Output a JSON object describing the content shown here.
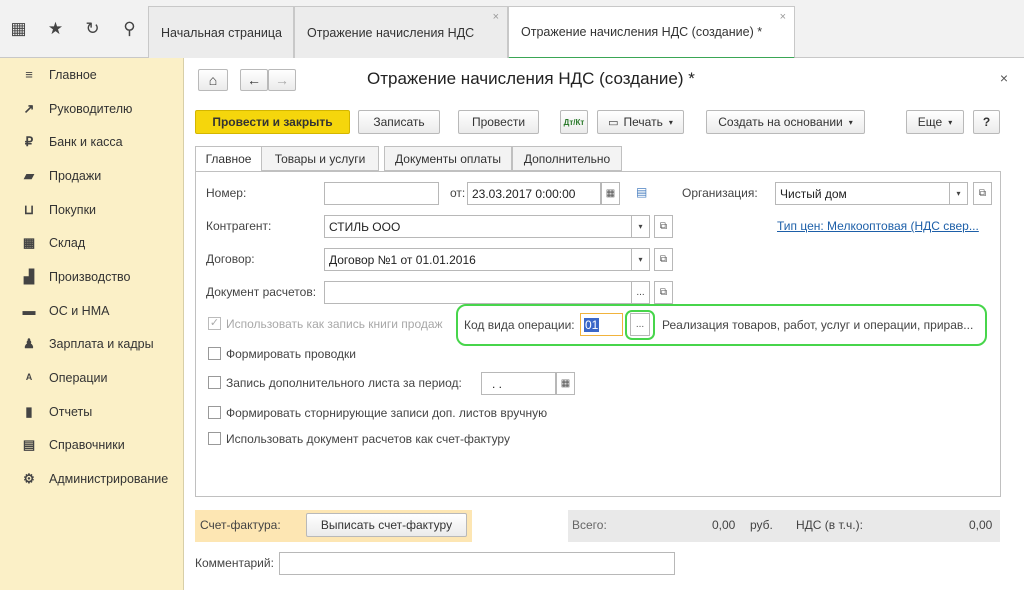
{
  "topbar": {
    "icons": [
      "apps-grid-icon",
      "star-icon",
      "history-icon",
      "search-icon"
    ],
    "tabs": [
      {
        "label": "Начальная страница"
      },
      {
        "label": "Отражение начисления НДС"
      },
      {
        "label": "Отражение начисления НДС (создание) *"
      }
    ],
    "close_glyph": "×"
  },
  "sidebar": {
    "items": [
      {
        "label": "Главное",
        "icon": "menu-icon",
        "glyph": "≡"
      },
      {
        "label": "Руководителю",
        "icon": "trend-icon",
        "glyph": "↗"
      },
      {
        "label": "Банк и касса",
        "icon": "ruble-coin-icon",
        "glyph": "₽"
      },
      {
        "label": "Продажи",
        "icon": "bag-icon",
        "glyph": "▰"
      },
      {
        "label": "Покупки",
        "icon": "cart-icon",
        "glyph": "⊔"
      },
      {
        "label": "Склад",
        "icon": "warehouse-icon",
        "glyph": "▦"
      },
      {
        "label": "Производство",
        "icon": "factory-icon",
        "glyph": "▟"
      },
      {
        "label": "ОС и НМА",
        "icon": "truck-icon",
        "glyph": "▬"
      },
      {
        "label": "Зарплата и кадры",
        "icon": "person-icon",
        "glyph": "♟"
      },
      {
        "label": "Операции",
        "icon": "debit-credit-icon",
        "glyph": "ᴬ"
      },
      {
        "label": "Отчеты",
        "icon": "bar-chart-icon",
        "glyph": "▮"
      },
      {
        "label": "Справочники",
        "icon": "book-icon",
        "glyph": "▤"
      },
      {
        "label": "Администрирование",
        "icon": "gear-icon",
        "glyph": "⚙"
      }
    ]
  },
  "document": {
    "title": "Отражение начисления НДС (создание) *",
    "nav": {
      "home": "⌂",
      "back": "←",
      "forward": "→"
    },
    "toolbar": {
      "post_and_close": "Провести и закрыть",
      "save": "Записать",
      "post": "Провести",
      "dtkt": "Дт/Кт",
      "print": "Печать",
      "create_based_on": "Создать на основании",
      "more": "Еще",
      "help": "?"
    },
    "tabs": [
      "Главное",
      "Товары и услуги",
      "Документы оплаты",
      "Дополнительно"
    ],
    "fields": {
      "number_label": "Номер:",
      "number_value": "",
      "date_label": "от:",
      "date_value": "23.03.2017  0:00:00",
      "org_label": "Организация:",
      "org_value": "Чистый дом",
      "counterparty_label": "Контрагент:",
      "counterparty_value": "СТИЛЬ ООО",
      "price_type_link": "Тип цен: Мелкооптовая (НДС свер...",
      "contract_label": "Договор:",
      "contract_value": "Договор №1 от 01.01.2016",
      "settlement_doc_label": "Документ расчетов:",
      "settlement_doc_value": "",
      "ellipsis": "...",
      "use_as_book_record_label": "Использовать как запись книги продаж",
      "op_code_label": "Код вида операции:",
      "op_code_value": "01",
      "op_code_description": "Реализация товаров, работ, услуг и операции, прирав...",
      "form_entries_label": "Формировать проводки",
      "extra_sheet_label": "Запись дополнительного листа за период:",
      "extra_sheet_period": ". .",
      "storno_label": "Формировать сторнирующие записи доп. листов вручную",
      "use_settlement_as_invoice_label": "Использовать документ расчетов как счет-фактуру"
    },
    "footer": {
      "invoice_label": "Счет-фактура:",
      "invoice_button": "Выписать счет-фактуру",
      "total_label": "Всего:",
      "total_value": "0,00",
      "currency": "руб.",
      "vat_label": "НДС (в т.ч.):",
      "vat_value": "0,00",
      "comment_label": "Комментарий:",
      "comment_value": ""
    }
  },
  "colors": {
    "sidebar_bg": "#fbf0c7",
    "primary_button": "#f5d60c",
    "active_tab_underline": "#3aa655",
    "highlight": "#47d54b",
    "link": "#1d5fa8"
  }
}
